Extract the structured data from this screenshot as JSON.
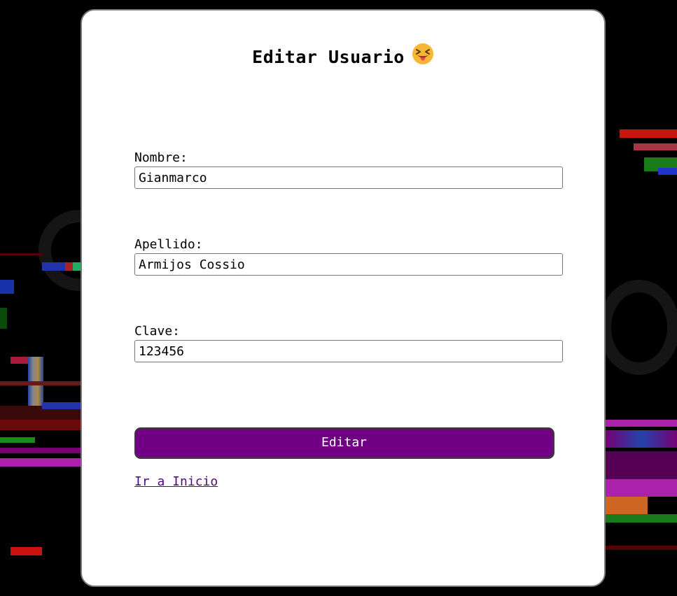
{
  "form": {
    "title": "Editar Usuario",
    "title_emoji_icon": "squinting-face-with-tongue-icon",
    "fields": [
      {
        "label": "Nombre:",
        "value": "Gianmarco"
      },
      {
        "label": "Apellido:",
        "value": "Armijos Cossio"
      },
      {
        "label": "Clave:",
        "value": "123456"
      }
    ],
    "submit_label": "Editar",
    "home_link_label": "Ir a Inicio"
  },
  "colors": {
    "page_background": "#000000",
    "card_background": "#ffffff",
    "button_background": "#720085",
    "button_text": "#ffffff",
    "link_color": "#4b0a82"
  }
}
